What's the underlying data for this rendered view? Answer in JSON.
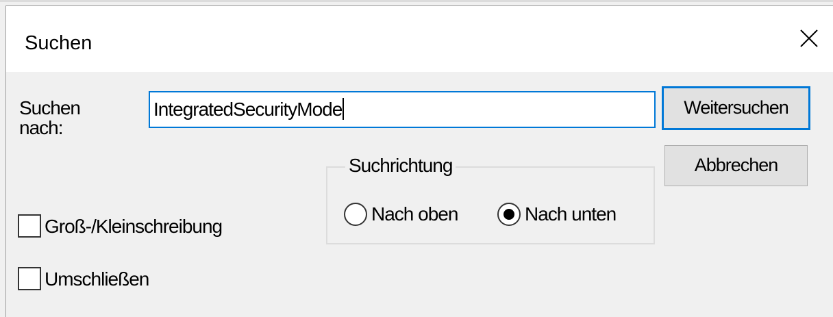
{
  "dialog": {
    "title": "Suchen",
    "close_icon": "close-icon"
  },
  "search": {
    "label_line1": "Suchen",
    "label_line2": "nach:",
    "value": "IntegratedSecurityMode"
  },
  "buttons": {
    "find_next": "Weitersuchen",
    "cancel": "Abbrechen"
  },
  "direction": {
    "legend": "Suchrichtung",
    "up_label": "Nach oben",
    "down_label": "Nach unten",
    "selected": "down"
  },
  "options": {
    "match_case_label": "Groß-/Kleinschreibung",
    "match_case_checked": false,
    "wrap_label": "Umschließen",
    "wrap_checked": false
  },
  "colors": {
    "accent": "#0078d7",
    "dialog_bg": "#f0f0f0",
    "button_bg": "#e1e1e1"
  }
}
